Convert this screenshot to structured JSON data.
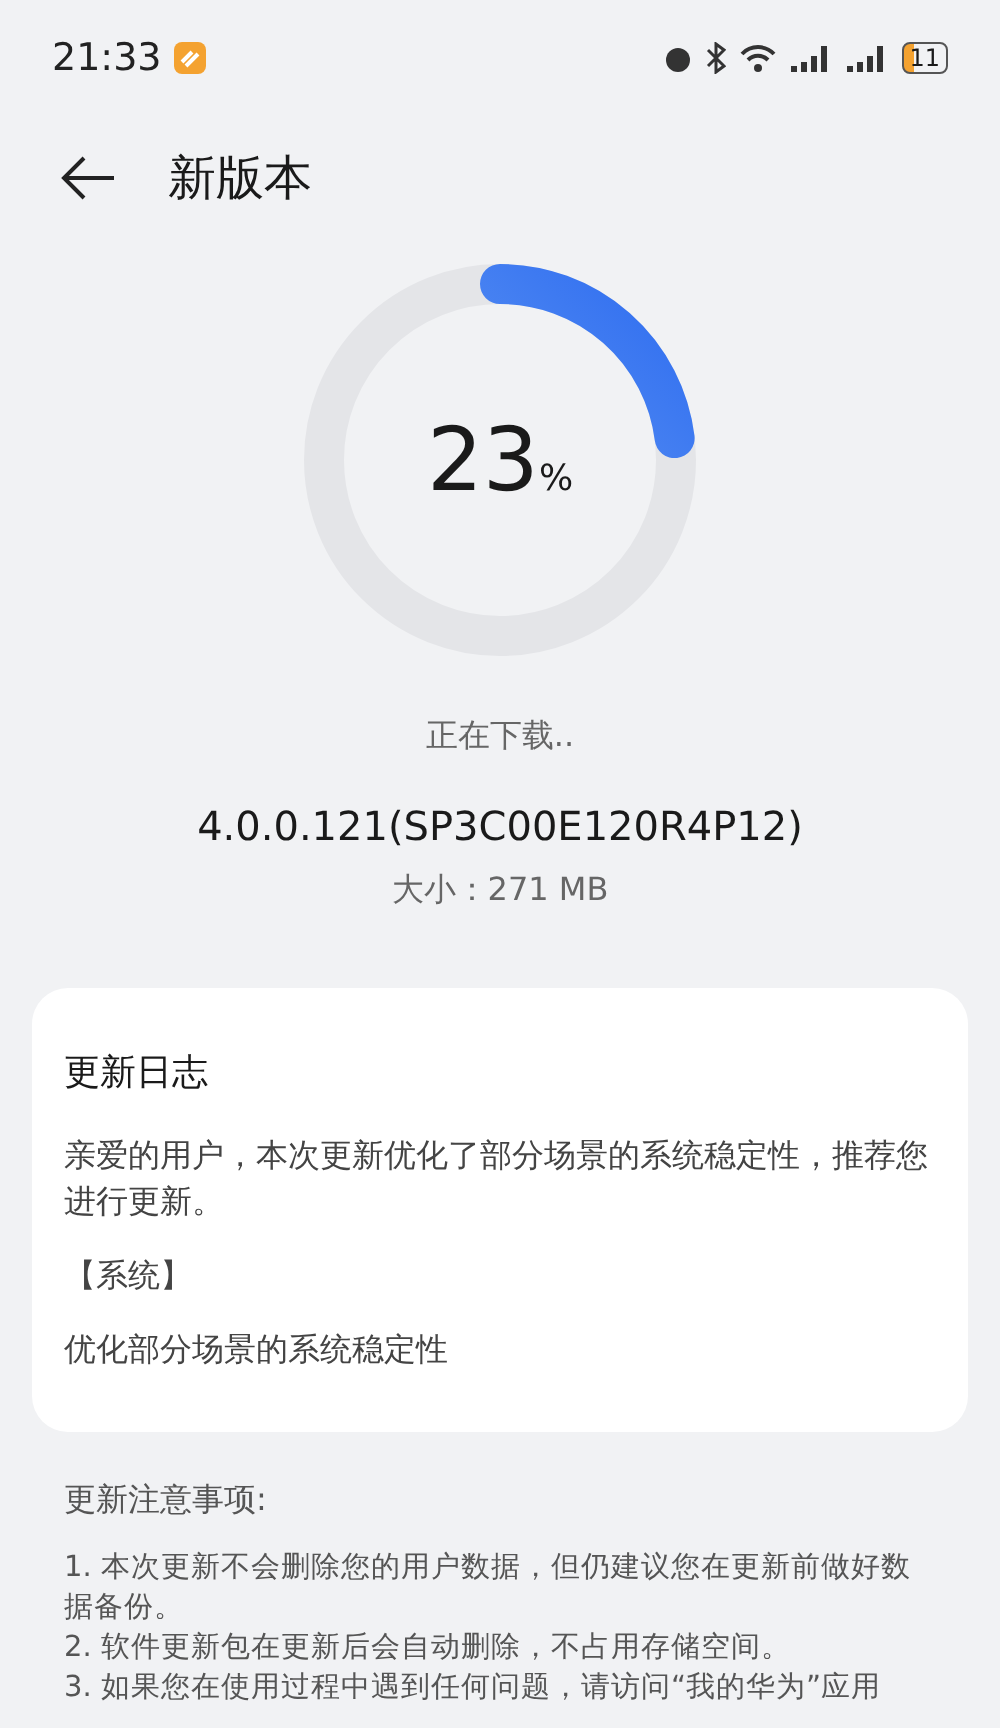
{
  "status_bar": {
    "time": "21:33",
    "battery": "11"
  },
  "header": {
    "title": "新版本"
  },
  "progress": {
    "level": 0.23,
    "value": "23",
    "unit": "%"
  },
  "download": {
    "status": "正在下载..",
    "version": "4.0.0.121(SP3C00E120R4P12)",
    "size": "大小：271 MB"
  },
  "changelog": {
    "title": "更新日志",
    "intro": "亲爱的用户，本次更新优化了部分场景的系统稳定性，推荐您进行更新。",
    "section": "【系统】",
    "item": "优化部分场景的系统稳定性"
  },
  "notes": {
    "title": "更新注意事项:",
    "items": [
      "1. 本次更新不会删除您的用户数据，但仍建议您在更新前做好数据备份。",
      "2. 软件更新包在更新后会自动删除，不占用存储空间。",
      "3. 如果您在使用过程中遇到任何问题，请访问“我的华为”应用"
    ]
  }
}
